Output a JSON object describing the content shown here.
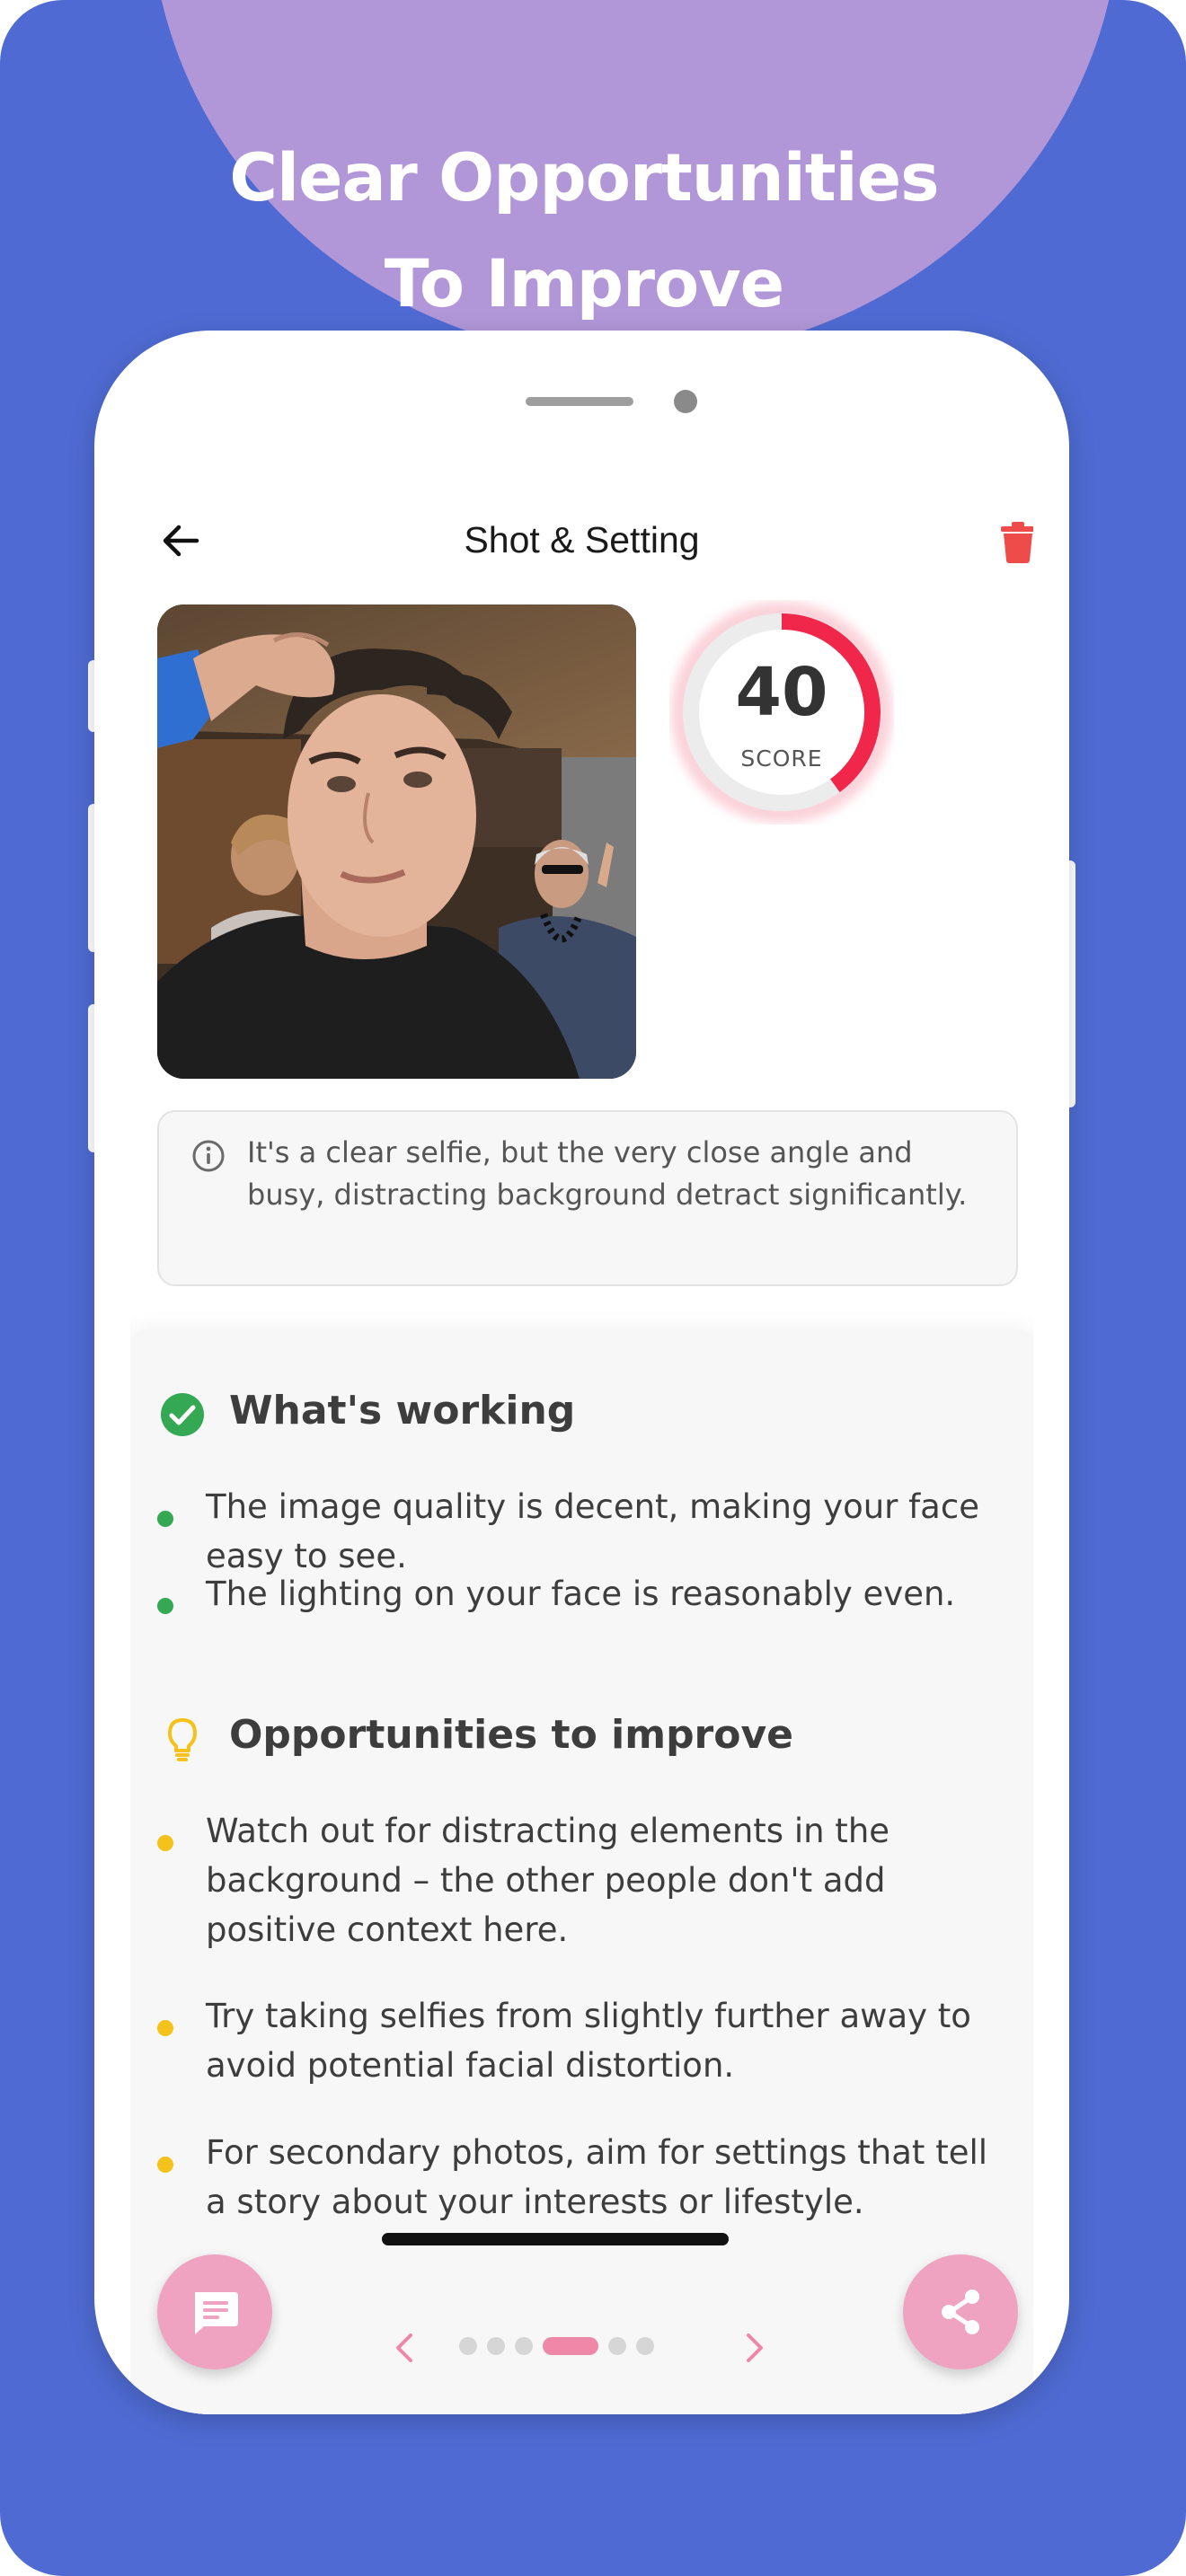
{
  "promo": {
    "headline_line1": "Clear Opportunities",
    "headline_line2": "To Improve"
  },
  "header": {
    "title": "Shot & Setting",
    "back_icon": "arrow-left-icon",
    "delete_icon": "trash-icon"
  },
  "score": {
    "value": "40",
    "label": "SCORE",
    "fraction": 0.4,
    "accent_color": "#f0264a"
  },
  "summary": {
    "icon": "info-icon",
    "text": "It's a clear selfie, but the very close angle and busy, distracting background detract significantly."
  },
  "sections": {
    "working": {
      "title": "What's working",
      "icon": "check-circle-icon",
      "color": "#34a853",
      "items": [
        "The image quality is decent, making your face easy to see.",
        "The lighting on your face is reasonably even."
      ]
    },
    "improve": {
      "title": "Opportunities to improve",
      "icon": "lightbulb-icon",
      "color": "#f5c21b",
      "items": [
        "Watch out for distracting elements in the background – the other people don't add positive context here.",
        "Try taking selfies from slightly further away to avoid potential facial distortion.",
        "For secondary photos, aim for settings that tell a story about your interests or lifestyle."
      ]
    }
  },
  "actions": {
    "chat_icon": "chat-bubble-icon",
    "share_icon": "share-icon",
    "fab_color": "#efa3c1"
  },
  "pager": {
    "total": 6,
    "current": 4,
    "prev_icon": "chevron-left-icon",
    "next_icon": "chevron-right-icon",
    "accent_color": "#ef88a8"
  },
  "colors": {
    "background": "#4f6bd3",
    "blob": "#b197d8"
  }
}
